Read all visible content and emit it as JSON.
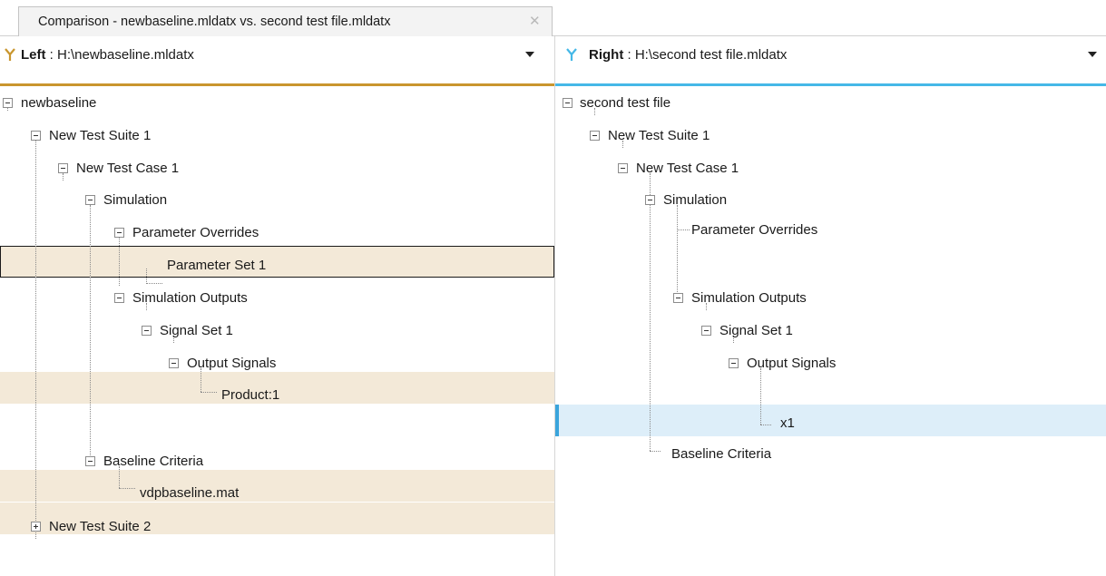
{
  "tab": {
    "title": "Comparison - newbaseline.mldatx vs. second test file.mldatx",
    "close_glyph": "✕"
  },
  "left": {
    "side_label": "Left",
    "path": " : H:\\newbaseline.mldatx",
    "accent": "#c9962e",
    "icon": "merge-branch-icon",
    "tree": {
      "root": "newbaseline",
      "suite1": "New Test Suite 1",
      "case1": "New Test Case 1",
      "simulation": "Simulation",
      "param_overrides": "Parameter Overrides",
      "param_set": "Parameter Set 1",
      "sim_outputs": "Simulation Outputs",
      "signal_set": "Signal Set 1",
      "output_signals": "Output Signals",
      "signal": "Product:1",
      "baseline_criteria": "Baseline Criteria",
      "baseline_file": "vdpbaseline.mat",
      "suite2": "New Test Suite 2"
    }
  },
  "right": {
    "side_label": "Right",
    "path": " : H:\\second test file.mldatx",
    "accent": "#45b8e7",
    "icon": "merge-branch-icon",
    "tree": {
      "root": "second test file",
      "suite1": "New Test Suite 1",
      "case1": "New Test Case 1",
      "simulation": "Simulation",
      "param_overrides": "Parameter Overrides",
      "sim_outputs": "Simulation Outputs",
      "signal_set": "Signal Set 1",
      "output_signals": "Output Signals",
      "signal": "x1",
      "baseline_criteria": "Baseline Criteria"
    }
  },
  "colors": {
    "changed_row": "#f3e9d8",
    "added_row": "#ddeef9",
    "added_marker": "#3aa5dc"
  }
}
